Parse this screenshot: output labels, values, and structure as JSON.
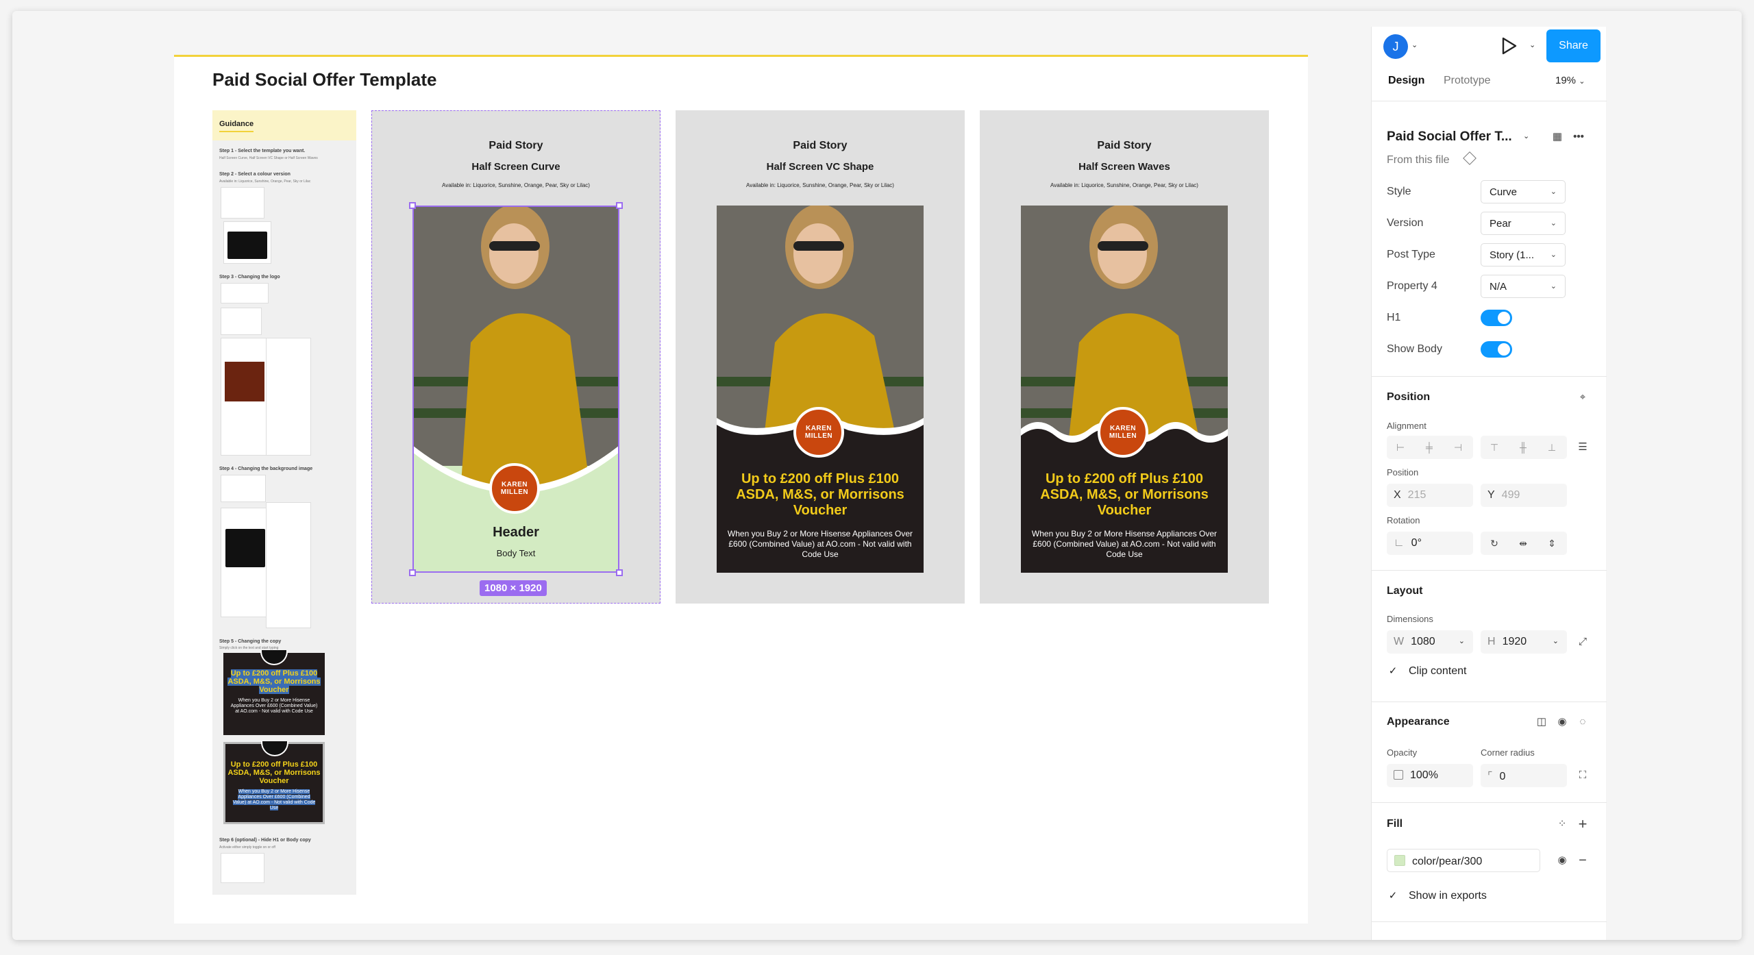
{
  "canvas": {
    "frame_title": "Paid Social Offer Template",
    "guidance": {
      "title": "Guidance",
      "steps": [
        {
          "title": "Step 1 - Select the template you want.",
          "note": "Half Screen Curve, Half Screen VC Shape or Half Screen Waves"
        },
        {
          "title": "Step 2 - Select a colour version",
          "note": "Available in: Liquorice, Sunshine, Orange, Pear, Sky or Lilac"
        },
        {
          "title": "Step 3 - Changing the logo"
        },
        {
          "title": "Step 4 - Changing the background image"
        },
        {
          "title": "Step 5 - Changing the copy",
          "note": "Simply click on the text and start typing"
        },
        {
          "title": "Step 6 (optional) - Hide H1 or Body copy",
          "note": "Activate either simply toggle on or off"
        }
      ],
      "promo_head": "Up to £200 off Plus £100 ASDA, M&S, or Morrisons Voucher",
      "promo_body": "When you Buy 2 or More Hisense Appliances Over £600 (Combined Value) at AO.com - Not valid with Code Use"
    },
    "artboards": [
      {
        "title": "Paid Story",
        "subtitle": "Half Screen Curve",
        "availability": "Available in: Liquorice, Sunshine, Orange, Pear, Sky or Lilac)",
        "logo": "KAREN MILLEN",
        "header": "Header",
        "body": "Body Text",
        "style": "curve"
      },
      {
        "title": "Paid Story",
        "subtitle": "Half Screen VC Shape",
        "availability": "Available in: Liquorice, Sunshine, Orange, Pear, Sky or Lilac)",
        "logo": "KAREN MILLEN",
        "header": "Up to £200 off Plus £100 ASDA, M&S, or Morrisons Voucher",
        "body": "When you Buy 2 or More Hisense Appliances Over £600 (Combined Value) at AO.com - Not valid with Code Use",
        "style": "vc"
      },
      {
        "title": "Paid Story",
        "subtitle": "Half Screen Waves",
        "availability": "Available in: Liquorice, Sunshine, Orange, Pear, Sky or Lilac)",
        "logo": "KAREN MILLEN",
        "header": "Up to £200 off Plus £100 ASDA, M&S, or Morrisons Voucher",
        "body": "When you Buy 2 or More Hisense Appliances Over £600 (Combined Value) at AO.com - Not valid with Code Use",
        "style": "waves"
      }
    ],
    "selection_badge": "1080 × 1920"
  },
  "panel": {
    "avatar_initial": "J",
    "share_label": "Share",
    "tabs": {
      "design": "Design",
      "prototype": "Prototype"
    },
    "zoom": "19%",
    "component": {
      "name": "Paid Social Offer T...",
      "source": "From this file",
      "props": [
        {
          "label": "Style",
          "value": "Curve"
        },
        {
          "label": "Version",
          "value": "Pear"
        },
        {
          "label": "Post Type",
          "value": "Story (1..."
        },
        {
          "label": "Property 4",
          "value": "N/A"
        }
      ],
      "toggles": [
        {
          "label": "H1",
          "on": true
        },
        {
          "label": "Show Body",
          "on": true
        }
      ]
    },
    "position": {
      "title": "Position",
      "alignment_label": "Alignment",
      "position_label": "Position",
      "x_prefix": "X",
      "x": "215",
      "y_prefix": "Y",
      "y": "499",
      "rotation_label": "Rotation",
      "rotation": "0°"
    },
    "layout": {
      "title": "Layout",
      "dimensions_label": "Dimensions",
      "w_prefix": "W",
      "w": "1080",
      "h_prefix": "H",
      "h": "1920",
      "clip_content": "Clip content"
    },
    "appearance": {
      "title": "Appearance",
      "opacity_label": "Opacity",
      "opacity": "100%",
      "radius_label": "Corner radius",
      "radius": "0"
    },
    "fill": {
      "title": "Fill",
      "color_name": "color/pear/300",
      "color_hex": "#d3ebc2",
      "show_in_exports": "Show in exports"
    }
  },
  "colors": {
    "accent": "#0d99ff",
    "selection": "#9b6cf0",
    "pear": "#d3ebc2",
    "dark": "#221c1c",
    "offer_yellow": "#f2cb1a",
    "logo_orange": "#c9470e"
  }
}
